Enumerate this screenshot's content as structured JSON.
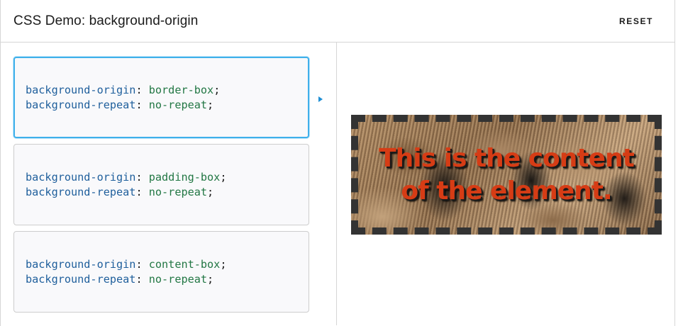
{
  "header": {
    "title": "CSS Demo: background-origin",
    "reset_label": "RESET"
  },
  "choices": [
    {
      "line1": {
        "prop": "background-origin",
        "value": "border-box"
      },
      "line2": {
        "prop": "background-repeat",
        "value": "no-repeat"
      },
      "selected": true
    },
    {
      "line1": {
        "prop": "background-origin",
        "value": "padding-box"
      },
      "line2": {
        "prop": "background-repeat",
        "value": "no-repeat"
      },
      "selected": false
    },
    {
      "line1": {
        "prop": "background-origin",
        "value": "content-box"
      },
      "line2": {
        "prop": "background-repeat",
        "value": "no-repeat"
      },
      "selected": false
    }
  ],
  "output": {
    "text": "This is the content of the element."
  },
  "colors": {
    "property": "#1f5f9c",
    "value": "#227744",
    "selected_border": "#3fb0ea",
    "example_text": "#d63c15",
    "indicator": "#1f8fd4"
  },
  "icons": {
    "indicator": "triangle-right-icon"
  }
}
